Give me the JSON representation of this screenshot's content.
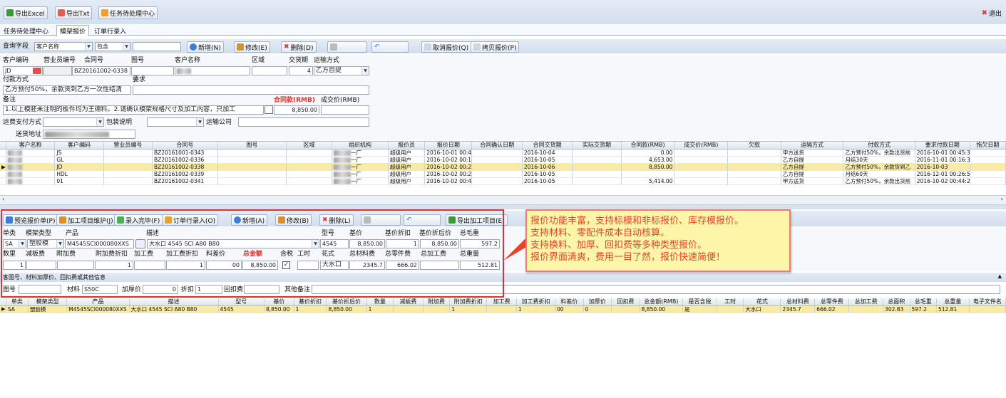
{
  "toolbar": {
    "export_excel": "导出Excel",
    "export_txt": "导出Txt",
    "task_center": "任务待处理中心",
    "exit": "退出"
  },
  "tabs": [
    {
      "label": "任务待处理中心"
    },
    {
      "label": "模架报价"
    },
    {
      "label": "订单行录入"
    }
  ],
  "query": {
    "field_label": "查询字段",
    "field_value": "客户名称",
    "op_value": "包含",
    "keyword": "",
    "new": "新增(N)",
    "edit": "修改(E)",
    "delete": "删除(D)",
    "cancel_quote": "取消报价(Q)",
    "copy_quote": "拷贝报价(P)"
  },
  "header_labels": {
    "customer_code": "客户编码",
    "salesman_code": "营业员编号",
    "contract_no": "合同号",
    "drawing_no": "图号",
    "customer_name": "客户名称",
    "region": "区域",
    "delivery_days": "交货期",
    "shipping": "运输方式",
    "payment": "付款方式",
    "requirement": "要求",
    "remark": "备注",
    "contract_amount": "合同款(RMB)",
    "deal_price": "成交价(RMB)",
    "freight_payment": "运费支付方式",
    "packing": "包装说明",
    "shipping_company": "运输公司",
    "delivery_address": "送货地址"
  },
  "header_values": {
    "customer_code": "JD",
    "contract_no": "BZ20161002-0338",
    "delivery_days": "4",
    "shipping": "乙方自提",
    "payment": "乙方预付50%，余款货到乙方一次性结清",
    "remark": "1.以上模胚未注明的板件均为王德料。2.请确认模架规格尺寸及加工内容，只加工",
    "contract_amount": "8,850.00"
  },
  "upper_table": {
    "headers": [
      "客户名称",
      "客户编码",
      "营业员编号",
      "合同号",
      "图号",
      "区域",
      "组织机构",
      "报价员",
      "报价日期",
      "合同确认日期",
      "合同交货期",
      "实际交货期",
      "合同款(RMB)",
      "成交价(RMB)",
      "欠款",
      "运输方式",
      "付款方式",
      "要求付款日期",
      "拖欠日期"
    ],
    "rows": [
      {
        "code": "JS",
        "contract": "BZ20161001-0343",
        "org": "一厂",
        "quoter": "超级用户",
        "qdate": "2016-10-01 00:45:29",
        "cdate": "2016-10-04",
        "amount": "0.00",
        "ship": "甲方送货",
        "pay": "乙方预付50%，余款出货前",
        "pdate": "2016-10-01 00:45:32"
      },
      {
        "code": "GL",
        "contract": "BZ20161002-0336",
        "org": "一厂",
        "quoter": "超级用户",
        "qdate": "2016-10-02 00:16:34",
        "cdate": "2016-10-05",
        "amount": "4,653.00",
        "ship": "乙方自提",
        "pay": "月结30天",
        "pdate": "2016-11-01 00:16:39"
      },
      {
        "code": "JD",
        "contract": "BZ20161002-0338",
        "org": "一厂",
        "quoter": "超级用户",
        "qdate": "2016-10-02 00:20:38",
        "cdate": "2016-10-06",
        "amount": "8,850.00",
        "ship": "乙方自提",
        "pay": "乙方预付50%，余款货到乙",
        "pdate": "2016-10-03"
      },
      {
        "code": "HDL",
        "contract": "BZ20161002-0339",
        "org": "一厂",
        "quoter": "超级用户",
        "qdate": "2016-10-02 00:26:52",
        "cdate": "2016-10-05",
        "amount": "",
        "ship": "乙方自提",
        "pay": "月结60天",
        "pdate": "2016-12-01 00:26:57"
      },
      {
        "code": "01",
        "contract": "BZ20161002-0341",
        "org": "一厂",
        "quoter": "超级用户",
        "qdate": "2016-10-02 00:44:15",
        "cdate": "2016-10-05",
        "amount": "5,414.00",
        "ship": "甲方送货",
        "pay": "乙方预付50%，余款出货前",
        "pdate": "2016-10-02 00:44:26"
      }
    ]
  },
  "detail_toolbar": {
    "preview": "预览报价单(P)",
    "process_maint": "加工项目维护(J)",
    "entry_done": "录入完毕(F)",
    "order_entry": "订单行录入(O)",
    "new": "新增(A)",
    "edit": "修改(B)",
    "delete": "删除(L)",
    "export_items": "导出加工项目(E)"
  },
  "detail_labels": {
    "unit_type": "单类",
    "mold_type": "模架类型",
    "product": "产品",
    "desc": "描述",
    "model": "型号",
    "base_price": "基价",
    "discount": "基价折扣",
    "after_discount": "基价折后价",
    "gross_weight": "总毛重",
    "qty": "数里",
    "reduce_fee": "减板费",
    "extra_fee": "附加费",
    "extra_discount": "附加费折扣",
    "process_fee": "加工费",
    "process_discount": "加工费折扣",
    "diff_price": "料差价",
    "total": "总金额",
    "tax": "含税",
    "hours": "工时",
    "pattern": "花式",
    "material_cost": "总材料费",
    "parts_cost": "总零件费",
    "process_total": "总加工费",
    "total_weight": "总重量"
  },
  "detail_values": {
    "unit_type": "SA",
    "mold_type": "塑胶模",
    "product": "M4545SCI000080XXS",
    "desc": "大水口 4545 SCI A80 B80",
    "model": "4545",
    "base_price": "8,850.00",
    "discount": "1",
    "after_discount": "8,850.00",
    "gross_weight": "597.2",
    "qty": "1",
    "extra_discount": "1",
    "process_discount": "1",
    "diff_price": "00",
    "total": "8,850.00",
    "pattern": "大水口",
    "material_cost": "2345.7",
    "parts_cost": "666.02",
    "total_weight": "512.81"
  },
  "extra_section": {
    "title": "客图号、材料加厚价、回扣费或其他信息",
    "drawing": "图号",
    "material": "材料",
    "material_value": "S50C",
    "thicken": "加厚价",
    "thicken_value": "0",
    "discount": "折扣",
    "discount_value": "1",
    "rebate": "回扣费",
    "other": "其他备注"
  },
  "lower_table": {
    "headers": [
      "单类",
      "模架类型",
      "产品",
      "描述",
      "型号",
      "基价",
      "基价折扣",
      "基价折后价",
      "数量",
      "减板费",
      "附加费",
      "附加费折扣",
      "加工费",
      "加工费折扣",
      "料差价",
      "加厚价",
      "回扣费",
      "总金额(RMB)",
      "是否含税",
      "工时",
      "花式",
      "总材料费",
      "总零件费",
      "总加工费",
      "总面积",
      "总毛重",
      "总重量",
      "电子文件名"
    ],
    "row": [
      "SA",
      "塑胶模",
      "M4545SCI000080XXS",
      "大水口 4545 SCI A80 B80",
      "4545",
      "8,850.00",
      "1",
      "8,850.00",
      "1",
      "",
      "",
      "1",
      "",
      "1",
      "00",
      "0",
      "",
      "8,850.00",
      "是",
      "",
      "大水口",
      "2345.7",
      "666.02",
      "",
      "302.83",
      "597.2",
      "512.81",
      ""
    ]
  },
  "callout": {
    "lines": [
      "报价功能丰富，支持标模和非标报价、库存模报价。",
      "支持材料、零配件成本自动核算。",
      "支持换料、加厚、回扣费等多种类型报价。",
      "报价界面清爽，费用一目了然，报价快速简便！"
    ]
  },
  "colors": {
    "accent_red": "#e8422c",
    "selected_row": "#fbe9a8",
    "callout_bg": "#fdf6a8"
  }
}
